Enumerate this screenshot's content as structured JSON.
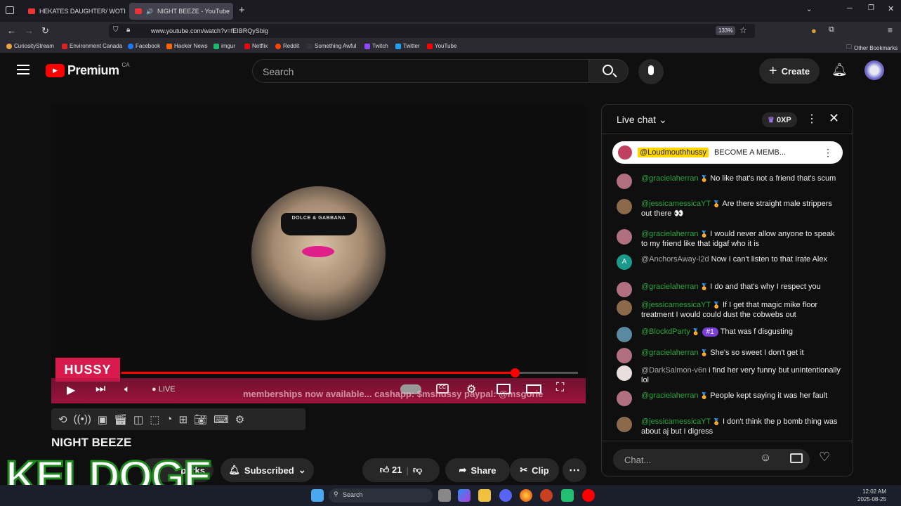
{
  "browser": {
    "tabs": [
      {
        "title": "HEKATES DAUGHTER/ WOTI & |"
      },
      {
        "title": "NIGHT BEEZE - YouTube"
      }
    ],
    "url": "www.youtube.com/watch?v=fEIBRQySbig",
    "zoom": "133%",
    "bookmarks": [
      "CuriosityStream",
      "Environment Canada",
      "Facebook",
      "Hacker News",
      "imgur",
      "Netflix",
      "Reddit",
      "Something Awful",
      "Twitch",
      "Twitter",
      "YouTube"
    ],
    "other_bookmarks": "Other Bookmarks"
  },
  "youtube": {
    "logo_text": "Premium",
    "region": "CA",
    "search_placeholder": "Search",
    "create_label": "Create"
  },
  "player": {
    "overlay_label": "HUSSY",
    "glasses_text": "DOLCE & GABBANA",
    "live_label": "LIVE",
    "marquee": "memberships now available... cashapp: $mshussy paypal: @msgorie",
    "progress": 0.86
  },
  "video": {
    "title": "NIGHT BEEZE",
    "perks_label": "perks",
    "subscribed_label": "Subscribed",
    "like_count": "21",
    "share_label": "Share",
    "clip_label": "Clip"
  },
  "chat": {
    "header": "Live chat",
    "points": "0XP",
    "pinned": {
      "user": "@Loudmouthhussy",
      "text": "BECOME A MEMB..."
    },
    "messages": [
      {
        "user": "@gracielaherran",
        "text": "No like that's not a friend that's scum",
        "color": "#b07080"
      },
      {
        "user": "@jessicamessicaYT",
        "text": "Are there straight male strippers out there 👀",
        "color": "#8a6a4a"
      },
      {
        "user": "@gracielaherran",
        "text": "I would never allow anyone to speak to my friend like that idgaf who it is",
        "color": "#b07080"
      },
      {
        "user": "@AnchorsAway-l2d",
        "text": "Now I can't listen to that Irate Alex",
        "color": "#1a9a8a"
      },
      {
        "user": "@gracielaherran",
        "text": "I do and that's why I respect you",
        "color": "#b07080"
      },
      {
        "user": "@jessicamessicaYT",
        "text": "If I get that magic mike floor treatment I would could dust the cobwebs out",
        "color": "#8a6a4a"
      },
      {
        "user": "@BlockdParty",
        "badge": "#1",
        "text": "That was f disgusting",
        "color": "#5a8aa0"
      },
      {
        "user": "@gracielaherran",
        "text": "She's so sweet I don't get it",
        "color": "#b07080"
      },
      {
        "user": "@DarkSalmon-v6n",
        "text": "i find her very funny but unintentionally lol",
        "color": "#e8dede"
      },
      {
        "user": "@gracielaherran",
        "text": "People kept saying it was her fault",
        "color": "#b07080"
      },
      {
        "user": "@jessicamessicaYT",
        "text": "I don't think the p bomb thing was about aj but I digress",
        "color": "#8a6a4a"
      }
    ],
    "input_placeholder": "Chat..."
  },
  "watermark": "KELDOGE",
  "taskbar": {
    "search": "Search",
    "time": "12:02 AM",
    "date": "2025-08-25"
  }
}
